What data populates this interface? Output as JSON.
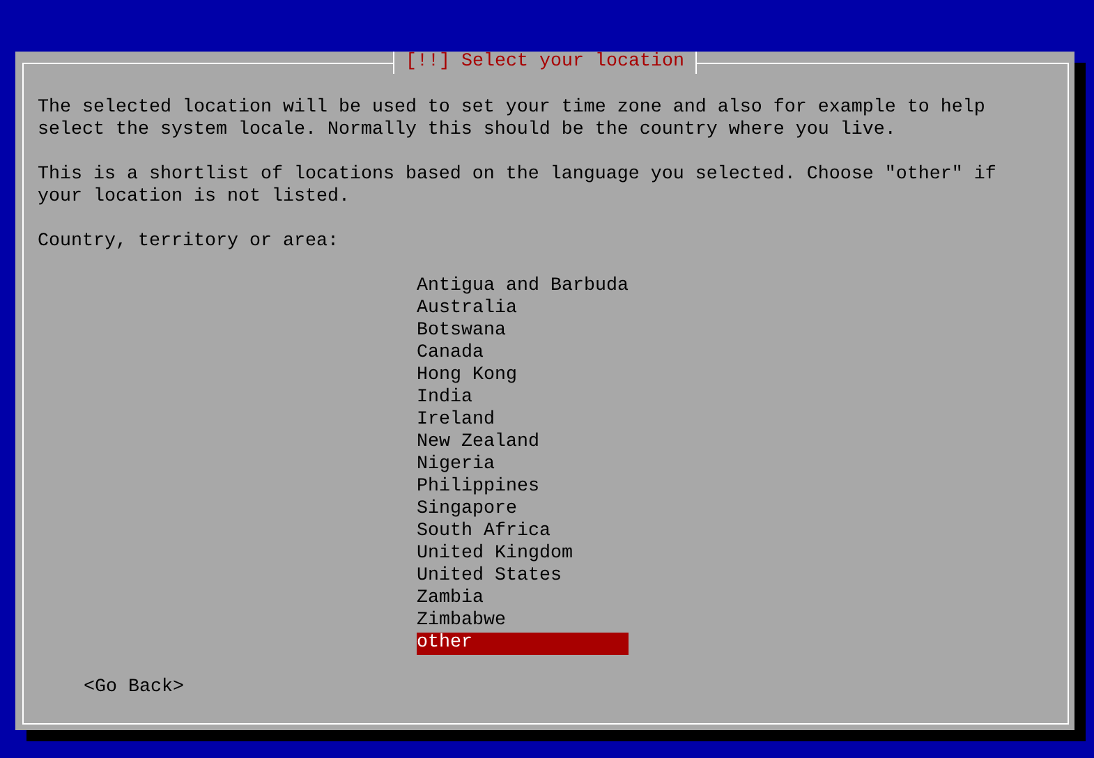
{
  "dialog": {
    "title": "[!!] Select your location",
    "paragraphs": [
      "The selected location will be used to set your time zone and also for example to help select the system locale. Normally this should be the country where you live.",
      "This is a shortlist of locations based on the language you selected. Choose \"other\" if your location is not listed."
    ],
    "prompt": "Country, territory or area:",
    "options": [
      {
        "label": "Antigua and Barbuda",
        "selected": false
      },
      {
        "label": "Australia",
        "selected": false
      },
      {
        "label": "Botswana",
        "selected": false
      },
      {
        "label": "Canada",
        "selected": false
      },
      {
        "label": "Hong Kong",
        "selected": false
      },
      {
        "label": "India",
        "selected": false
      },
      {
        "label": "Ireland",
        "selected": false
      },
      {
        "label": "New Zealand",
        "selected": false
      },
      {
        "label": "Nigeria",
        "selected": false
      },
      {
        "label": "Philippines",
        "selected": false
      },
      {
        "label": "Singapore",
        "selected": false
      },
      {
        "label": "South Africa",
        "selected": false
      },
      {
        "label": "United Kingdom",
        "selected": false
      },
      {
        "label": "United States",
        "selected": false
      },
      {
        "label": "Zambia",
        "selected": false
      },
      {
        "label": "Zimbabwe",
        "selected": false
      },
      {
        "label": "other",
        "selected": true
      }
    ],
    "back_button": "<Go Back>"
  }
}
